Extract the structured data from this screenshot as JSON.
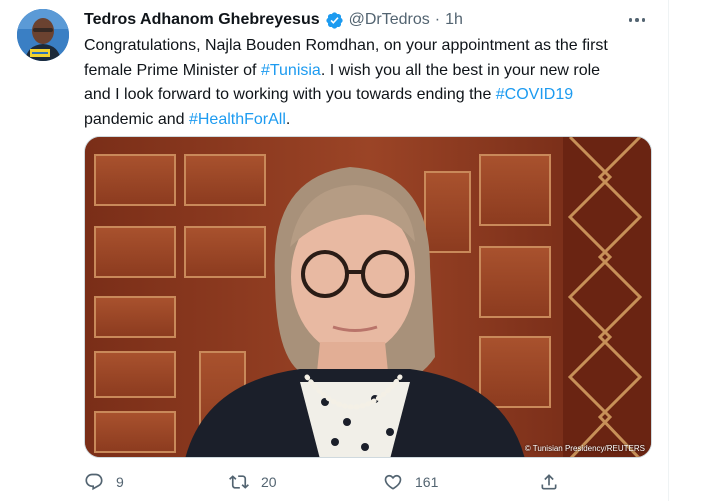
{
  "tweet": {
    "author": {
      "display_name": "Tedros Adhanom Ghebreyesus",
      "handle": "@DrTedros",
      "separator": "·",
      "time": "1h",
      "verified_icon": "verified-badge-icon"
    },
    "body": {
      "line1": "Congratulations, Najla Bouden Romdhan, on your appointment as the first",
      "line2_before": "female Prime Minister of ",
      "line2_tag": "#Tunisia",
      "line2_after": ". I wish you all the best in your new role",
      "line3_before": "and I look forward to working with you towards ending the ",
      "line3_tag": "#COVID19",
      "line4_before": "pandemic and ",
      "line4_tag": "#HealthForAll",
      "line4_after": "."
    },
    "media": {
      "credit": "© Tunisian Presidency/REUTERS"
    },
    "actions": {
      "replies": "9",
      "retweets": "20",
      "likes": "161"
    }
  },
  "colors": {
    "link": "#1d9bf0",
    "secondary_text": "#536471",
    "verified": "#1d9bf0"
  },
  "icons": {
    "reply": "reply-icon",
    "retweet": "retweet-icon",
    "like": "like-icon",
    "share": "share-icon",
    "more": "more-icon"
  }
}
